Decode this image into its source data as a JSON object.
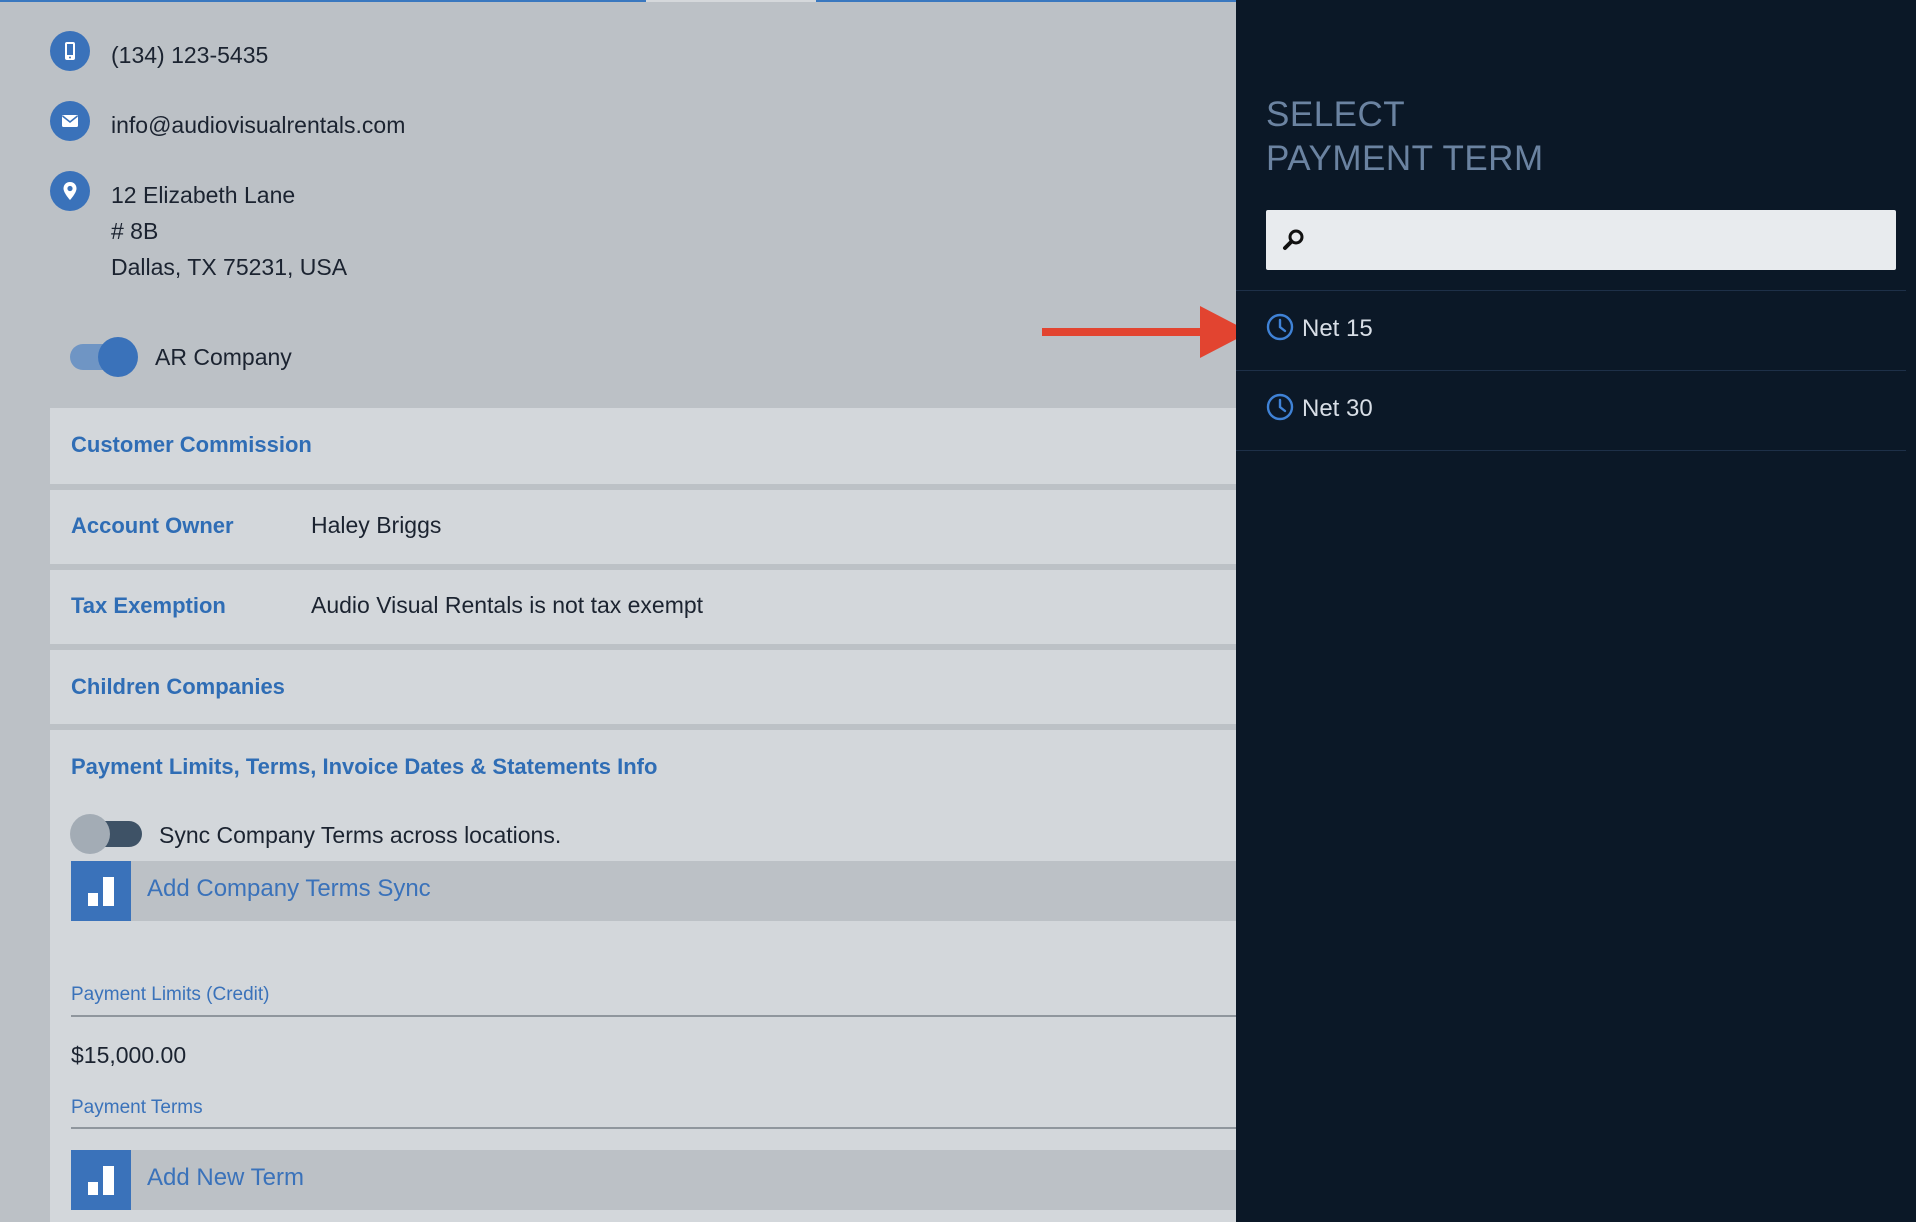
{
  "contact": {
    "phone": "(134) 123-5435",
    "email": "info@audiovisualrentals.com",
    "address_line1": "12 Elizabeth Lane",
    "address_line2": "# 8B",
    "address_line3": "Dallas, TX 75231, USA"
  },
  "ar_company": {
    "label": "AR Company",
    "on": true
  },
  "sections": {
    "customer_commission": {
      "title": "Customer Commission"
    },
    "account_owner": {
      "title": "Account Owner",
      "value": "Haley Briggs"
    },
    "tax_exemption": {
      "title": "Tax Exemption",
      "value": "Audio Visual Rentals is not tax exempt"
    },
    "children_companies": {
      "title": "Children Companies"
    },
    "payment_limits": {
      "title": "Payment Limits, Terms, Invoice Dates & Statements Info"
    }
  },
  "sync_terms": {
    "label": "Sync Company Terms across locations.",
    "on": false
  },
  "add_company_terms_sync": {
    "label": "Add Company Terms Sync"
  },
  "payment_limits_credit": {
    "label": "Payment Limits (Credit)",
    "value": "$15,000.00"
  },
  "payment_terms": {
    "label": "Payment Terms"
  },
  "add_new_term": {
    "label": "Add New Term"
  },
  "panel": {
    "title_line1": "SELECT",
    "title_line2": "PAYMENT TERM",
    "search_placeholder": "",
    "items": [
      {
        "label": "Net 15"
      },
      {
        "label": "Net 30"
      }
    ]
  },
  "colors": {
    "accent_blue": "#3a72ba",
    "panel_bg": "#0b1827",
    "arrow_red": "#e24430"
  },
  "icons": {
    "phone": "phone-icon",
    "email": "envelope-icon",
    "address": "location-pin-icon",
    "search": "search-icon",
    "term": "clock-icon",
    "add": "bar-chart-icon"
  }
}
